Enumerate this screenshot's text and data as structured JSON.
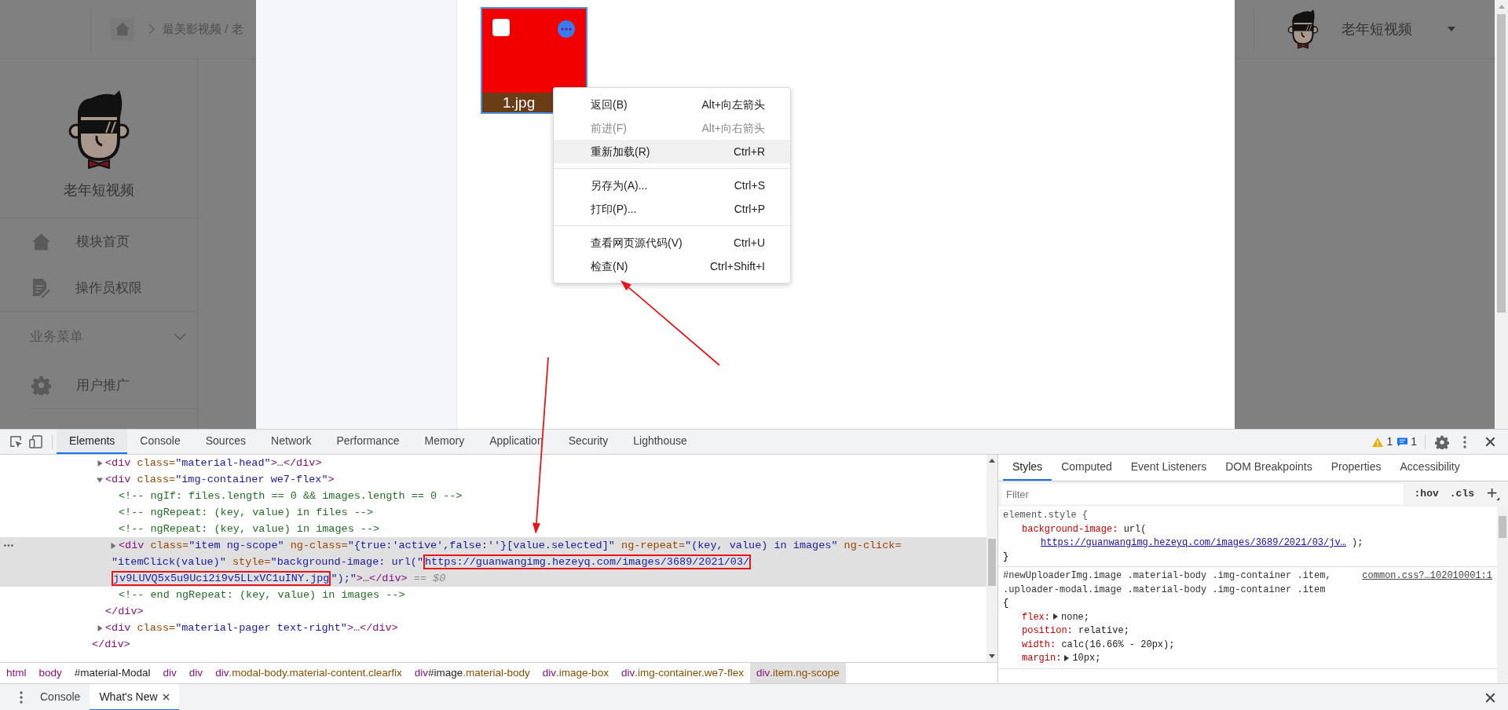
{
  "app": {
    "breadcrumb": "最美影视频 / 老",
    "user": {
      "name": "老年短视频"
    },
    "sidebar": {
      "brand": "老年短视频",
      "items": [
        {
          "label": "模块首页",
          "kind": "home"
        },
        {
          "label": "操作员权限",
          "kind": "document"
        }
      ],
      "sections": [
        {
          "title": "业务菜单",
          "expanded": true,
          "items": [
            {
              "label": "用户推广",
              "kind": "gear"
            }
          ]
        }
      ]
    }
  },
  "modal": {
    "images": [
      {
        "filename": "1.jpg",
        "selected": true
      }
    ]
  },
  "context_menu": {
    "groups": [
      [
        {
          "label": "返回(B)",
          "shortcut": "Alt+向左箭头",
          "disabled": false,
          "highlighted": false
        },
        {
          "label": "前进(F)",
          "shortcut": "Alt+向右箭头",
          "disabled": true,
          "highlighted": false
        },
        {
          "label": "重新加载(R)",
          "shortcut": "Ctrl+R",
          "disabled": false,
          "highlighted": true
        }
      ],
      [
        {
          "label": "另存为(A)...",
          "shortcut": "Ctrl+S",
          "disabled": false,
          "highlighted": false
        },
        {
          "label": "打印(P)...",
          "shortcut": "Ctrl+P",
          "disabled": false,
          "highlighted": false
        }
      ],
      [
        {
          "label": "查看网页源代码(V)",
          "shortcut": "Ctrl+U",
          "disabled": false,
          "highlighted": false
        },
        {
          "label": "检查(N)",
          "shortcut": "Ctrl+Shift+I",
          "disabled": false,
          "highlighted": false
        }
      ]
    ]
  },
  "devtools": {
    "tabs": [
      {
        "label": "Elements",
        "selected": true
      },
      {
        "label": "Console",
        "selected": false
      },
      {
        "label": "Sources",
        "selected": false
      },
      {
        "label": "Network",
        "selected": false
      },
      {
        "label": "Performance",
        "selected": false
      },
      {
        "label": "Memory",
        "selected": false
      },
      {
        "label": "Application",
        "selected": false
      },
      {
        "label": "Security",
        "selected": false
      },
      {
        "label": "Lighthouse",
        "selected": false
      }
    ],
    "issues": {
      "warnings": "1",
      "messages": "1"
    },
    "dom_tree": [
      {
        "children": [
          {
            "selected": false,
            "expanded": false,
            "lines": [
              [
                {
                  "kind": "tag",
                  "text": "<div"
                },
                {
                  "kind": "attr",
                  "text": " class="
                },
                {
                  "kind": "value",
                  "text": "\"material-head\""
                },
                {
                  "kind": "tag",
                  "text": ">"
                },
                {
                  "kind": "text",
                  "text": "…"
                },
                {
                  "kind": "tag",
                  "text": "</div>"
                }
              ]
            ]
          },
          {
            "selected": false,
            "expanded": true,
            "lines": [
              [
                {
                  "kind": "tag",
                  "text": "<div"
                },
                {
                  "kind": "attr",
                  "text": " class="
                },
                {
                  "kind": "value",
                  "text": "\"img-container we7-flex\""
                },
                {
                  "kind": "tag",
                  "text": ">"
                }
              ]
            ],
            "children": [
              {
                "selected": false,
                "lines": [
                  [
                    {
                      "kind": "comment",
                      "text": "<!-- ngIf: files.length == 0 && images.length == 0 -->"
                    }
                  ]
                ]
              },
              {
                "selected": false,
                "lines": [
                  [
                    {
                      "kind": "comment",
                      "text": "<!-- ngRepeat: (key, value) in files -->"
                    }
                  ]
                ]
              },
              {
                "selected": false,
                "lines": [
                  [
                    {
                      "kind": "comment",
                      "text": "<!-- ngRepeat: (key, value) in images -->"
                    }
                  ]
                ]
              },
              {
                "selected": true,
                "expanded": false,
                "lines": [
                  [
                    {
                      "kind": "tag",
                      "text": "<div"
                    },
                    {
                      "kind": "attr",
                      "text": " class="
                    },
                    {
                      "kind": "value",
                      "text": "\"item ng-scope\""
                    },
                    {
                      "kind": "attr",
                      "text": " ng-class="
                    },
                    {
                      "kind": "value",
                      "text": "\"{true:'active',false:''}[value.selected]\""
                    },
                    {
                      "kind": "attr",
                      "text": " ng-repeat="
                    },
                    {
                      "kind": "value",
                      "text": "\"(key, value) in images\""
                    },
                    {
                      "kind": "attr",
                      "text": " ng-click="
                    }
                  ],
                  [
                    {
                      "kind": "value",
                      "text": "\"itemClick(value)\""
                    },
                    {
                      "kind": "attr",
                      "text": " style="
                    },
                    {
                      "kind": "value",
                      "text": "\"background-image: url(\""
                    },
                    {
                      "kind": "url",
                      "text": "https://guanwangimg.hezeyq.com/images/3689/2021/03/",
                      "boxed": true
                    }
                  ],
                  [
                    {
                      "kind": "url",
                      "text": "jv9LUVQ5x5u9Uci2i9v5LLxVC1uINY.jpg",
                      "boxed": true
                    },
                    {
                      "kind": "value",
                      "text": "\");\""
                    },
                    {
                      "kind": "tag",
                      "text": ">"
                    },
                    {
                      "kind": "text",
                      "text": "…"
                    },
                    {
                      "kind": "tag",
                      "text": "</div>"
                    },
                    {
                      "kind": "marker",
                      "text": " == $0"
                    }
                  ]
                ]
              },
              {
                "selected": false,
                "lines": [
                  [
                    {
                      "kind": "comment",
                      "text": "<!-- end ngRepeat: (key, value) in images -->"
                    }
                  ]
                ]
              }
            ],
            "closing": [
              {
                "kind": "tag",
                "text": "</div>"
              }
            ]
          },
          {
            "selected": false,
            "expanded": false,
            "lines": [
              [
                {
                  "kind": "tag",
                  "text": "<div"
                },
                {
                  "kind": "attr",
                  "text": " class="
                },
                {
                  "kind": "value",
                  "text": "\"material-pager text-right\""
                },
                {
                  "kind": "tag",
                  "text": ">"
                },
                {
                  "kind": "text",
                  "text": "…"
                },
                {
                  "kind": "tag",
                  "text": "</div>"
                }
              ]
            ]
          }
        ],
        "closing": [
          {
            "kind": "tag",
            "text": "</div>"
          }
        ]
      }
    ],
    "breadcrumbs": [
      {
        "tag": "html",
        "selected": false
      },
      {
        "tag": "body",
        "selected": false
      },
      {
        "id": "#material-Modal",
        "selected": false
      },
      {
        "tag": "div",
        "selected": false
      },
      {
        "tag": "div",
        "selected": false
      },
      {
        "tag": "div",
        "classes": ".modal-body.material-content.clearfix",
        "selected": false
      },
      {
        "tag": "div",
        "id": "#image",
        "classes": ".material-body",
        "selected": false
      },
      {
        "tag": "div",
        "classes": ".image-box",
        "selected": false
      },
      {
        "tag": "div",
        "classes": ".img-container.we7-flex",
        "selected": false
      },
      {
        "tag": "div",
        "classes": ".item.ng-scope",
        "selected": true
      }
    ],
    "styles": {
      "tabs": [
        {
          "label": "Styles",
          "selected": true
        },
        {
          "label": "Computed",
          "selected": false
        },
        {
          "label": "Event Listeners",
          "selected": false
        },
        {
          "label": "DOM Breakpoints",
          "selected": false
        },
        {
          "label": "Properties",
          "selected": false
        },
        {
          "label": "Accessibility",
          "selected": false
        }
      ],
      "filter": {
        "placeholder": "Filter"
      },
      "toggles": [
        ":hov",
        ".cls"
      ],
      "rules": [
        {
          "selector": "element.style",
          "open": "{",
          "close": "}",
          "declarations": [
            {
              "property": "background-image:",
              "value": "url(",
              "link": "https://guanwangimg.hezeyq.com/images/3689/2021/03/jv…",
              "value_end": " );"
            }
          ]
        },
        {
          "selector": "#newUploaderImg.image .material-body .img-container .item, .uploader-modal.image .material-body .img-container .item",
          "source": "common.css?…102010001:1",
          "open": "{",
          "declarations": [
            {
              "property": "flex:",
              "expandable": true,
              "value": "none;"
            },
            {
              "property": "position:",
              "value": "relative;"
            },
            {
              "property": "width:",
              "value": "calc(16.66% - 20px);"
            },
            {
              "property": "margin:",
              "expandable": true,
              "value": "10px;"
            }
          ]
        }
      ]
    },
    "drawer": {
      "tabs": [
        {
          "label": "Console",
          "selected": false,
          "closable": false
        },
        {
          "label": "What's New",
          "selected": true,
          "closable": true
        }
      ]
    }
  }
}
